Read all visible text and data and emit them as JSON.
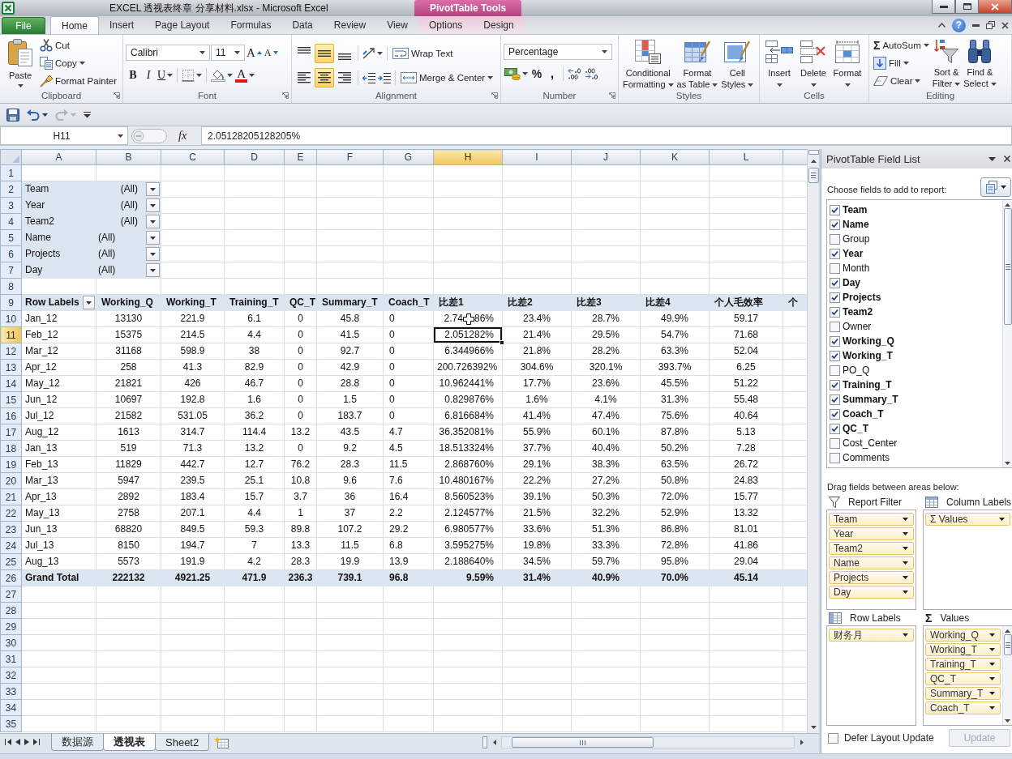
{
  "window": {
    "title": "EXCEL 透视表终章 分享材料.xlsx - Microsoft Excel",
    "tool_group": "PivotTable Tools",
    "help": "?"
  },
  "ribbon_tabs": [
    {
      "label": "File",
      "kind": "file",
      "selected": false
    },
    {
      "label": "Home",
      "kind": "standard",
      "selected": true
    },
    {
      "label": "Insert",
      "kind": "standard",
      "selected": false
    },
    {
      "label": "Page Layout",
      "kind": "standard",
      "selected": false
    },
    {
      "label": "Formulas",
      "kind": "standard",
      "selected": false
    },
    {
      "label": "Data",
      "kind": "standard",
      "selected": false
    },
    {
      "label": "Review",
      "kind": "standard",
      "selected": false
    },
    {
      "label": "View",
      "kind": "standard",
      "selected": false
    },
    {
      "label": "Options",
      "kind": "contextual",
      "selected": false
    },
    {
      "label": "Design",
      "kind": "contextual",
      "selected": false
    }
  ],
  "ribbon_groups": [
    {
      "kind": "clipboard",
      "title": "Clipboard",
      "launcher": true,
      "paste": "Paste",
      "actions": [
        {
          "kind": "cut",
          "label": "Cut",
          "dropdown": false
        },
        {
          "kind": "copy",
          "label": "Copy",
          "dropdown": true
        },
        {
          "kind": "painter",
          "label": "Format Painter",
          "dropdown": false
        }
      ]
    },
    {
      "kind": "font",
      "title": "Font",
      "launcher": true,
      "font_name": "Calibri",
      "font_size": "11",
      "grow": "A",
      "shrink": "A",
      "styles": [
        "B",
        "I",
        "U"
      ],
      "font_color": "A"
    },
    {
      "kind": "alignment",
      "title": "Alignment",
      "launcher": true,
      "vertical": [
        {
          "kind": "top",
          "selected": false
        },
        {
          "kind": "middle",
          "selected": true
        },
        {
          "kind": "bottom",
          "selected": false
        }
      ],
      "horizontal": [
        {
          "kind": "left",
          "selected": false
        },
        {
          "kind": "center",
          "selected": true
        },
        {
          "kind": "right",
          "selected": false
        }
      ],
      "wrap": "Wrap Text",
      "merge": "Merge & Center"
    },
    {
      "kind": "number",
      "title": "Number",
      "launcher": true,
      "format": "Percentage",
      "percent": "%",
      "comma": ","
    },
    {
      "kind": "styles",
      "title": "Styles",
      "launcher": false,
      "buttons": [
        {
          "kind": "conditional",
          "lines": [
            "Conditional",
            "Formatting"
          ]
        },
        {
          "kind": "table",
          "lines": [
            "Format",
            "as Table"
          ]
        },
        {
          "kind": "cell",
          "lines": [
            "Cell",
            "Styles"
          ]
        }
      ]
    },
    {
      "kind": "cells",
      "title": "Cells",
      "launcher": false,
      "buttons": [
        {
          "kind": "insert",
          "label": "Insert"
        },
        {
          "kind": "delete",
          "label": "Delete"
        },
        {
          "kind": "format",
          "label": "Format"
        }
      ]
    },
    {
      "kind": "editing",
      "title": "Editing",
      "launcher": false,
      "small": [
        {
          "kind": "autosum",
          "symbol": "Σ",
          "label": "AutoSum"
        },
        {
          "kind": "fill",
          "label": "Fill"
        },
        {
          "kind": "clear",
          "label": "Clear"
        }
      ],
      "big": [
        {
          "kind": "sort",
          "lines": [
            "Sort &",
            "Filter"
          ]
        },
        {
          "kind": "find",
          "lines": [
            "Find &",
            "Select"
          ]
        }
      ]
    }
  ],
  "quick_access": [
    {
      "kind": "save",
      "disabled": false
    },
    {
      "kind": "undo",
      "disabled": false
    },
    {
      "kind": "redo",
      "disabled": true
    },
    {
      "kind": "customize",
      "disabled": false
    }
  ],
  "formula_bar": {
    "name_box": "H11",
    "function_button": "fx",
    "formula": "2.05128205128205%"
  },
  "sheet": {
    "columns": [
      {
        "label": "A",
        "selected": false
      },
      {
        "label": "B",
        "selected": false
      },
      {
        "label": "C",
        "selected": false
      },
      {
        "label": "D",
        "selected": false
      },
      {
        "label": "E",
        "selected": false
      },
      {
        "label": "F",
        "selected": false
      },
      {
        "label": "G",
        "selected": false
      },
      {
        "label": "H",
        "selected": true
      },
      {
        "label": "I",
        "selected": false
      },
      {
        "label": "J",
        "selected": false
      },
      {
        "label": "K",
        "selected": false
      },
      {
        "label": "L",
        "selected": false
      }
    ],
    "row_numbers": [
      {
        "label": "1",
        "selected": false
      },
      {
        "label": "2",
        "selected": false
      },
      {
        "label": "3",
        "selected": false
      },
      {
        "label": "4",
        "selected": false
      },
      {
        "label": "5",
        "selected": false
      },
      {
        "label": "6",
        "selected": false
      },
      {
        "label": "7",
        "selected": false
      },
      {
        "label": "8",
        "selected": false
      },
      {
        "label": "9",
        "selected": false
      },
      {
        "label": "10",
        "selected": false
      },
      {
        "label": "11",
        "selected": true
      },
      {
        "label": "12",
        "selected": false
      },
      {
        "label": "13",
        "selected": false
      },
      {
        "label": "14",
        "selected": false
      },
      {
        "label": "15",
        "selected": false
      },
      {
        "label": "16",
        "selected": false
      },
      {
        "label": "17",
        "selected": false
      },
      {
        "label": "18",
        "selected": false
      },
      {
        "label": "19",
        "selected": false
      },
      {
        "label": "20",
        "selected": false
      },
      {
        "label": "21",
        "selected": false
      },
      {
        "label": "22",
        "selected": false
      },
      {
        "label": "23",
        "selected": false
      },
      {
        "label": "24",
        "selected": false
      },
      {
        "label": "25",
        "selected": false
      },
      {
        "label": "26",
        "selected": false
      },
      {
        "label": "27",
        "selected": false
      },
      {
        "label": "28",
        "selected": false
      },
      {
        "label": "29",
        "selected": false
      },
      {
        "label": "30",
        "selected": false
      },
      {
        "label": "31",
        "selected": false
      },
      {
        "label": "32",
        "selected": false
      },
      {
        "label": "33",
        "selected": false
      },
      {
        "label": "34",
        "selected": false
      },
      {
        "label": "35",
        "selected": false
      }
    ],
    "report_filters": [
      {
        "field": "Team",
        "value": "(All)",
        "right_aligned": true
      },
      {
        "field": "Year",
        "value": "(All)",
        "right_aligned": true
      },
      {
        "field": "Team2",
        "value": "(All)",
        "right_aligned": true
      },
      {
        "field": "Name",
        "value": "(All)",
        "right_aligned": false
      },
      {
        "field": "Projects",
        "value": "(All)",
        "right_aligned": false
      },
      {
        "field": "Day",
        "value": "(All)",
        "right_aligned": false
      }
    ],
    "pivot": {
      "row_labels": "Row Labels",
      "value_columns": [
        "Working_Q",
        "Working_T",
        "Training_T",
        "QC_T",
        "Summary_T",
        "Coach_T",
        "比差1",
        "比差2",
        "比差3",
        "比差4",
        "个人毛效率",
        "个"
      ],
      "rows": [
        {
          "label": "Jan_12",
          "values": [
            "13130",
            "221.9",
            "6.1",
            "0",
            "45.8",
            "0",
            {
              "before": "2.74",
              "after": "86%"
            },
            "23.4%",
            "28.7%",
            "49.9%",
            "59.17"
          ]
        },
        {
          "label": "Feb_12",
          "values": [
            "15375",
            "214.5",
            "4.4",
            "0",
            "41.5",
            "0",
            "2.051282%",
            "21.4%",
            "29.5%",
            "54.7%",
            "71.68"
          ]
        },
        {
          "label": "Mar_12",
          "values": [
            "31168",
            "598.9",
            "38",
            "0",
            "92.7",
            "0",
            "6.344966%",
            "21.8%",
            "28.2%",
            "63.3%",
            "52.04"
          ]
        },
        {
          "label": "Apr_12",
          "values": [
            "258",
            "41.3",
            "82.9",
            "0",
            "42.9",
            "0",
            "200.726392%",
            "304.6%",
            "320.1%",
            "393.7%",
            "6.25"
          ]
        },
        {
          "label": "May_12",
          "values": [
            "21821",
            "426",
            "46.7",
            "0",
            "28.8",
            "0",
            "10.962441%",
            "17.7%",
            "23.6%",
            "45.5%",
            "51.22"
          ]
        },
        {
          "label": "Jun_12",
          "values": [
            "10697",
            "192.8",
            "1.6",
            "0",
            "1.5",
            "0",
            "0.829876%",
            "1.6%",
            "4.1%",
            "31.3%",
            "55.48"
          ]
        },
        {
          "label": "Jul_12",
          "values": [
            "21582",
            "531.05",
            "36.2",
            "0",
            "183.7",
            "0",
            "6.816684%",
            "41.4%",
            "47.4%",
            "75.6%",
            "40.64"
          ]
        },
        {
          "label": "Aug_12",
          "values": [
            "1613",
            "314.7",
            "114.4",
            "13.2",
            "43.5",
            "4.7",
            "36.352081%",
            "55.9%",
            "60.1%",
            "87.8%",
            "5.13"
          ]
        },
        {
          "label": "Jan_13",
          "values": [
            "519",
            "71.3",
            "13.2",
            "0",
            "9.2",
            "4.5",
            "18.513324%",
            "37.7%",
            "40.4%",
            "50.2%",
            "7.28"
          ]
        },
        {
          "label": "Feb_13",
          "values": [
            "11829",
            "442.7",
            "12.7",
            "76.2",
            "28.3",
            "11.5",
            "2.868760%",
            "29.1%",
            "38.3%",
            "63.5%",
            "26.72"
          ]
        },
        {
          "label": "Mar_13",
          "values": [
            "5947",
            "239.5",
            "25.1",
            "10.8",
            "9.6",
            "7.6",
            "10.480167%",
            "22.2%",
            "27.2%",
            "50.8%",
            "24.83"
          ]
        },
        {
          "label": "Apr_13",
          "values": [
            "2892",
            "183.4",
            "15.7",
            "3.7",
            "36",
            "16.4",
            "8.560523%",
            "39.1%",
            "50.3%",
            "72.0%",
            "15.77"
          ]
        },
        {
          "label": "May_13",
          "values": [
            "2758",
            "207.1",
            "4.4",
            "1",
            "37",
            "2.2",
            "2.124577%",
            "21.5%",
            "32.2%",
            "52.9%",
            "13.32"
          ]
        },
        {
          "label": "Jun_13",
          "values": [
            "68820",
            "849.5",
            "59.3",
            "89.8",
            "107.2",
            "29.2",
            "6.980577%",
            "33.6%",
            "51.3%",
            "86.8%",
            "81.01"
          ]
        },
        {
          "label": "Jul_13",
          "values": [
            "8150",
            "194.7",
            "7",
            "13.3",
            "11.5",
            "6.8",
            "3.595275%",
            "19.8%",
            "33.3%",
            "72.8%",
            "41.86"
          ]
        },
        {
          "label": "Aug_13",
          "values": [
            "5573",
            "191.9",
            "4.2",
            "28.3",
            "19.9",
            "13.9",
            "2.188640%",
            "34.5%",
            "59.7%",
            "95.8%",
            "29.04"
          ]
        }
      ],
      "grand_total": {
        "label": "Grand Total",
        "values": [
          "222132",
          "4921.25",
          "471.9",
          "236.3",
          "739.1",
          "96.8",
          "9.59%",
          "31.4%",
          "40.9%",
          "70.0%",
          "45.14"
        ]
      }
    }
  },
  "sheet_tabs": [
    {
      "label": "数据源",
      "selected": false
    },
    {
      "label": "透视表",
      "selected": true
    },
    {
      "label": "Sheet2",
      "selected": false
    }
  ],
  "field_list": {
    "title": "PivotTable Field List",
    "prompt": "Choose fields to add to report:",
    "fields": [
      {
        "label": "Team",
        "checked": true
      },
      {
        "label": "Name",
        "checked": true
      },
      {
        "label": "Group",
        "checked": false
      },
      {
        "label": "Year",
        "checked": true
      },
      {
        "label": "Month",
        "checked": false
      },
      {
        "label": "Day",
        "checked": true
      },
      {
        "label": "Projects",
        "checked": true
      },
      {
        "label": "Team2",
        "checked": true
      },
      {
        "label": "Owner",
        "checked": false
      },
      {
        "label": "Working_Q",
        "checked": true
      },
      {
        "label": "Working_T",
        "checked": true
      },
      {
        "label": "PO_Q",
        "checked": false
      },
      {
        "label": "Training_T",
        "checked": true
      },
      {
        "label": "Summary_T",
        "checked": true
      },
      {
        "label": "Coach_T",
        "checked": true
      },
      {
        "label": "QC_T",
        "checked": true
      },
      {
        "label": "Cost_Center",
        "checked": false
      },
      {
        "label": "Comments",
        "checked": false
      }
    ],
    "drag_prompt": "Drag fields between areas below:",
    "areas": [
      {
        "kind": "filter",
        "title": "Report Filter",
        "scrollbar": false,
        "items": [
          "Team",
          "Year",
          "Team2",
          "Name",
          "Projects",
          "Day"
        ]
      },
      {
        "kind": "columns",
        "title": "Column Labels",
        "scrollbar": false,
        "items": [
          "Σ Values"
        ]
      },
      {
        "kind": "rows",
        "title": "Row Labels",
        "scrollbar": false,
        "items": [
          "财务月"
        ]
      },
      {
        "kind": "values",
        "title": "Values",
        "symbol": "Σ",
        "scrollbar": true,
        "items": [
          "Working_Q",
          "Working_T",
          "Training_T",
          "QC_T",
          "Summary_T",
          "Coach_T"
        ]
      }
    ],
    "defer": {
      "label": "Defer Layout Update",
      "checked": false
    },
    "update": {
      "label": "Update",
      "disabled": true
    }
  }
}
